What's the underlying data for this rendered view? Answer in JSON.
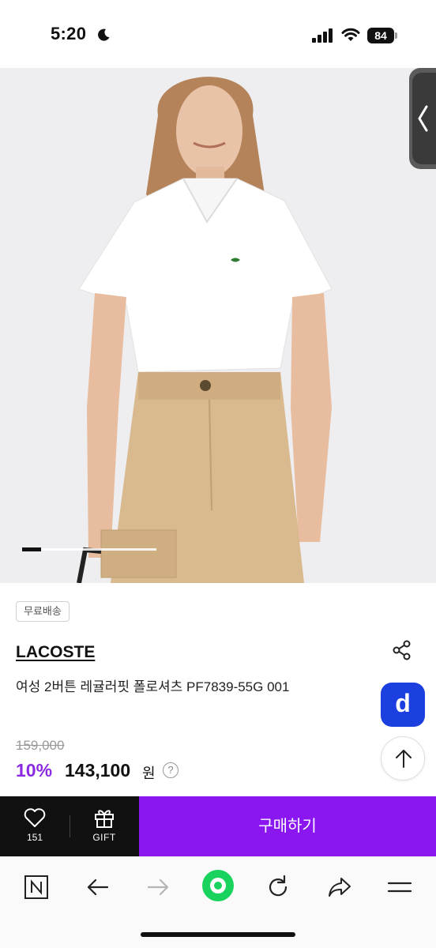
{
  "status_bar": {
    "time": "5:20",
    "battery": "84"
  },
  "hero": {
    "slide_progress": 0.14
  },
  "product": {
    "badge": "무료배송",
    "brand": "LACOSTE",
    "name": "여성 2버튼 레귤러핏 폴로셔츠 PF7839-55G 001",
    "original_price": "159,000",
    "discount": "10%",
    "price": "143,100",
    "price_unit": "원",
    "help": "?"
  },
  "fab": {
    "app_label": "d"
  },
  "action_bar": {
    "like_count": "151",
    "gift_label": "GIFT",
    "buy_label": "구매하기"
  },
  "colors": {
    "accent_purple": "#8a16f0",
    "discount_purple": "#8a2be2",
    "app_blue": "#1c3fe0",
    "home_green": "#19d35e"
  }
}
